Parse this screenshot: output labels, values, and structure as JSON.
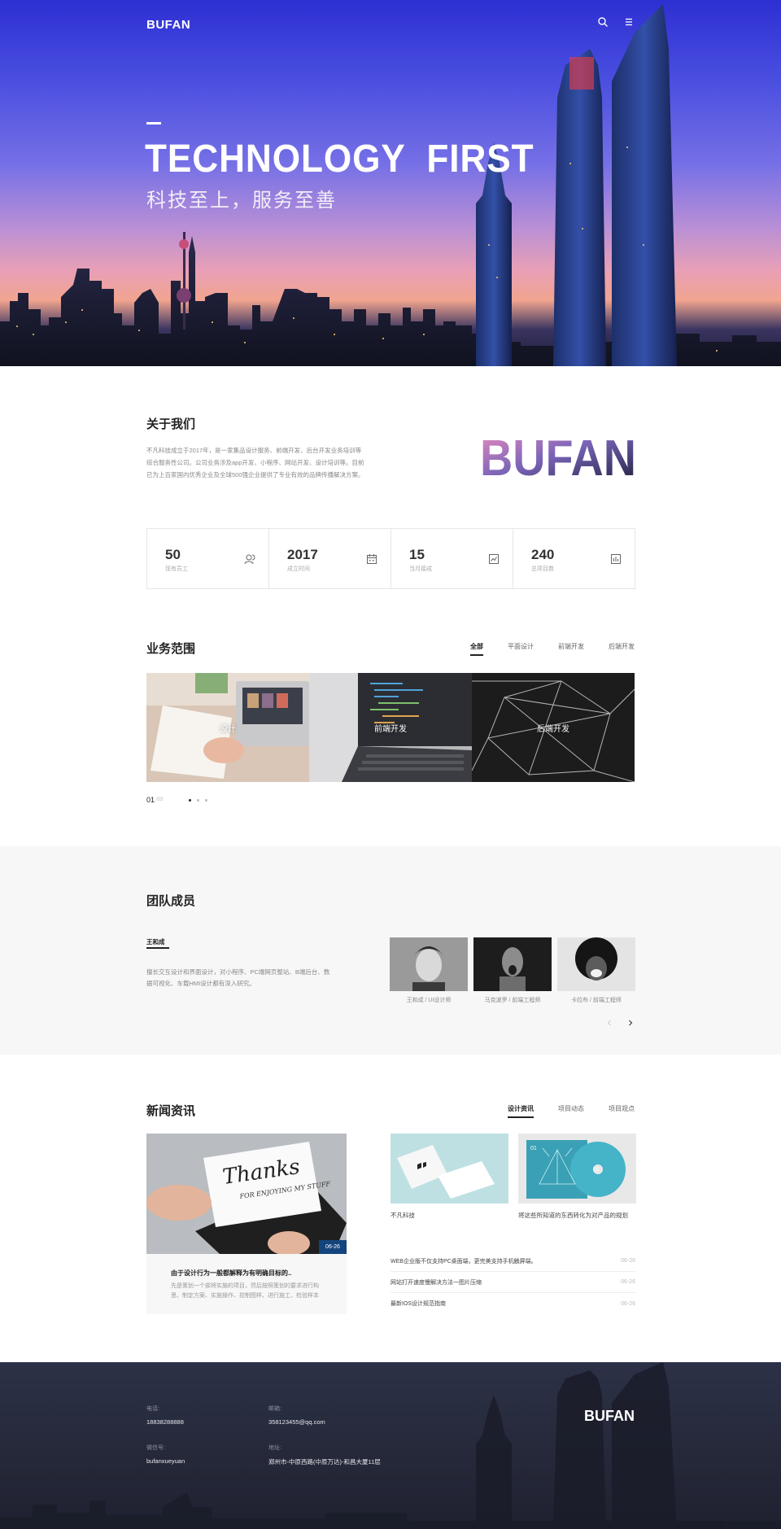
{
  "header": {
    "logo": "BUFAN",
    "icons": [
      "search-icon",
      "menu-icon"
    ]
  },
  "hero": {
    "title": "TECHNOLOGY  FIRST",
    "subtitle": "科技至上，服务至善"
  },
  "about": {
    "title": "关于我们",
    "text": "不凡科技成立于2017年，是一家集品设计服务、前端开发、后台开发业务培训等综合服务性公司。公司业务涉及app开发、小程序、网站开发、设计培训等。目前已为上百家国内优秀企业及全球500强企业提供了专业有效的品牌传播解决方案。",
    "logo_text": "BUFAN"
  },
  "stats": [
    {
      "num": "50",
      "label": "现有员工",
      "icon": "user-icon"
    },
    {
      "num": "2017",
      "label": "成立时间",
      "icon": "calendar-icon"
    },
    {
      "num": "15",
      "label": "当月接成",
      "icon": "trend-icon"
    },
    {
      "num": "240",
      "label": "总项目数",
      "icon": "chart-icon"
    }
  ],
  "services": {
    "title": "业务范围",
    "tabs": [
      "全部",
      "平面设计",
      "前端开发",
      "后端开发"
    ],
    "active_tab": "全部",
    "cards": [
      {
        "label": "设计"
      },
      {
        "label": "前端开发"
      },
      {
        "label": "后端开发"
      }
    ],
    "pager": {
      "current": "01",
      "total": "/03"
    }
  },
  "team": {
    "title": "团队成员",
    "member_name": "王和成",
    "member_desc": "擅长交互设计和界面设计，对小程序、PC端网页整站、B端后台、数据可视化、车载HMI设计都有深入研究。",
    "members": [
      {
        "caption": "王和成 / UI设计师"
      },
      {
        "caption": "马克波罗 / 前端工程师"
      },
      {
        "caption": "卡拉布 / 前端工程师"
      }
    ]
  },
  "news": {
    "title": "新闻资讯",
    "tabs": [
      "设计资讯",
      "项目动态",
      "项目观点"
    ],
    "active_tab": "设计资讯",
    "main": {
      "date": "06-26",
      "title": "由于设计行为一般都解释为有明确目标的..",
      "desc": "先是策划一个部将实施的项目，然后按照策划的要求进行构思、制定方案、实施操作、控制图样、进行施工、检验样本"
    },
    "thumbs": [
      {
        "caption": "不凡科技"
      },
      {
        "caption": "将这些所知道的东西转化为对产品的规划"
      }
    ],
    "list": [
      {
        "title": "WEB企业版不仅支持PC桌面端，更完美支持手机触屏端。",
        "date": "06-26"
      },
      {
        "title": "网站打开速度慢解决方法一图片压缩",
        "date": "06-26"
      },
      {
        "title": "最新IOS设计规范指南",
        "date": "06-26"
      }
    ]
  },
  "footer": {
    "phone_label": "电话:",
    "phone": "18838288888",
    "email_label": "邮箱:",
    "email": "358123455@qq.com",
    "wechat_label": "微信号:",
    "wechat": "bufanxueyuan",
    "address_label": "地址:",
    "address": "郑州市-中原西路(中原万达)-和昌大厦11层",
    "logo": "BUFAN"
  }
}
